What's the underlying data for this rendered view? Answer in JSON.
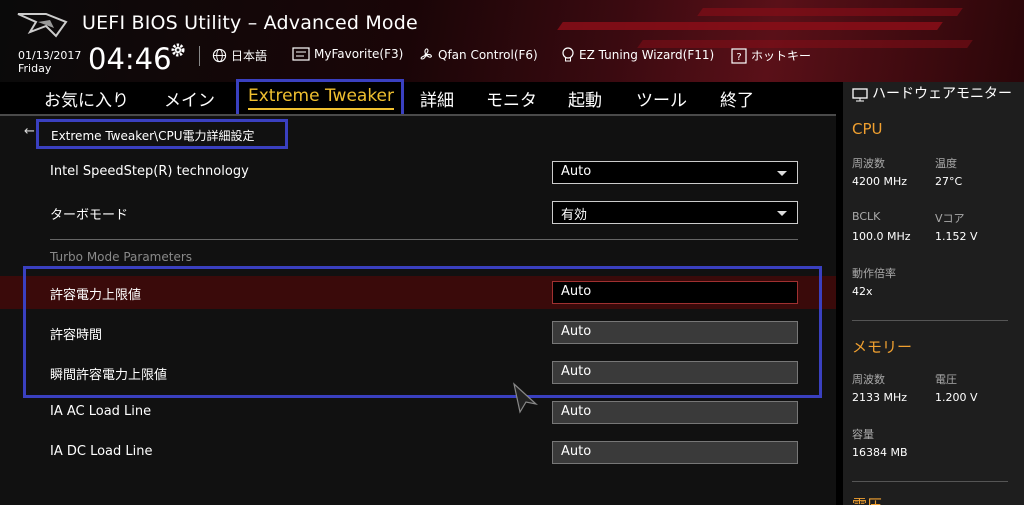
{
  "header": {
    "title": "UEFI BIOS Utility – Advanced Mode",
    "date": "01/13/2017",
    "day": "Friday",
    "time": "04:46",
    "toolbar": [
      {
        "label": "日本語",
        "icon": "globe-icon"
      },
      {
        "label": "MyFavorite(F3)",
        "icon": "favorite-icon"
      },
      {
        "label": "Qfan Control(F6)",
        "icon": "fan-icon"
      },
      {
        "label": "EZ Tuning Wizard(F11)",
        "icon": "bulb-icon"
      },
      {
        "label": "ホットキー",
        "icon": "help-icon"
      }
    ]
  },
  "nav": {
    "tabs": [
      "お気に入り",
      "メイン",
      "Extreme Tweaker",
      "詳細",
      "モニタ",
      "起動",
      "ツール",
      "終了"
    ],
    "active": "Extreme Tweaker"
  },
  "breadcrumb": "Extreme Tweaker\\CPU電力詳細設定",
  "settings": [
    {
      "label": "Intel SpeedStep(R) technology",
      "value": "Auto",
      "type": "select"
    },
    {
      "label": "ターボモード",
      "value": "有効",
      "type": "select"
    }
  ],
  "group": {
    "label": "Turbo Mode Parameters",
    "items": [
      {
        "label": "許容電力上限値",
        "value": "Auto"
      },
      {
        "label": "許容時間",
        "value": "Auto"
      },
      {
        "label": "瞬間許容電力上限値",
        "value": "Auto"
      },
      {
        "label": "IA AC Load Line",
        "value": "Auto"
      },
      {
        "label": "IA DC Load Line",
        "value": "Auto"
      }
    ]
  },
  "monitor": {
    "title": "ハードウェアモニター",
    "cpu": {
      "heading": "CPU",
      "freq_label": "周波数",
      "freq_value": "4200 MHz",
      "temp_label": "温度",
      "temp_value": "27°C",
      "bclk_label": "BCLK",
      "bclk_value": "100.0 MHz",
      "vcore_label": "Vコア",
      "vcore_value": "1.152 V",
      "ratio_label": "動作倍率",
      "ratio_value": "42x"
    },
    "memory": {
      "heading": "メモリー",
      "freq_label": "周波数",
      "freq_value": "2133 MHz",
      "volt_label": "電圧",
      "volt_value": "1.200 V",
      "cap_label": "容量",
      "cap_value": "16384 MB"
    },
    "voltage_heading": "電圧"
  },
  "colors": {
    "accent": "#f0c030",
    "highlight_box": "#3a40c0",
    "section": "#f0a030"
  }
}
